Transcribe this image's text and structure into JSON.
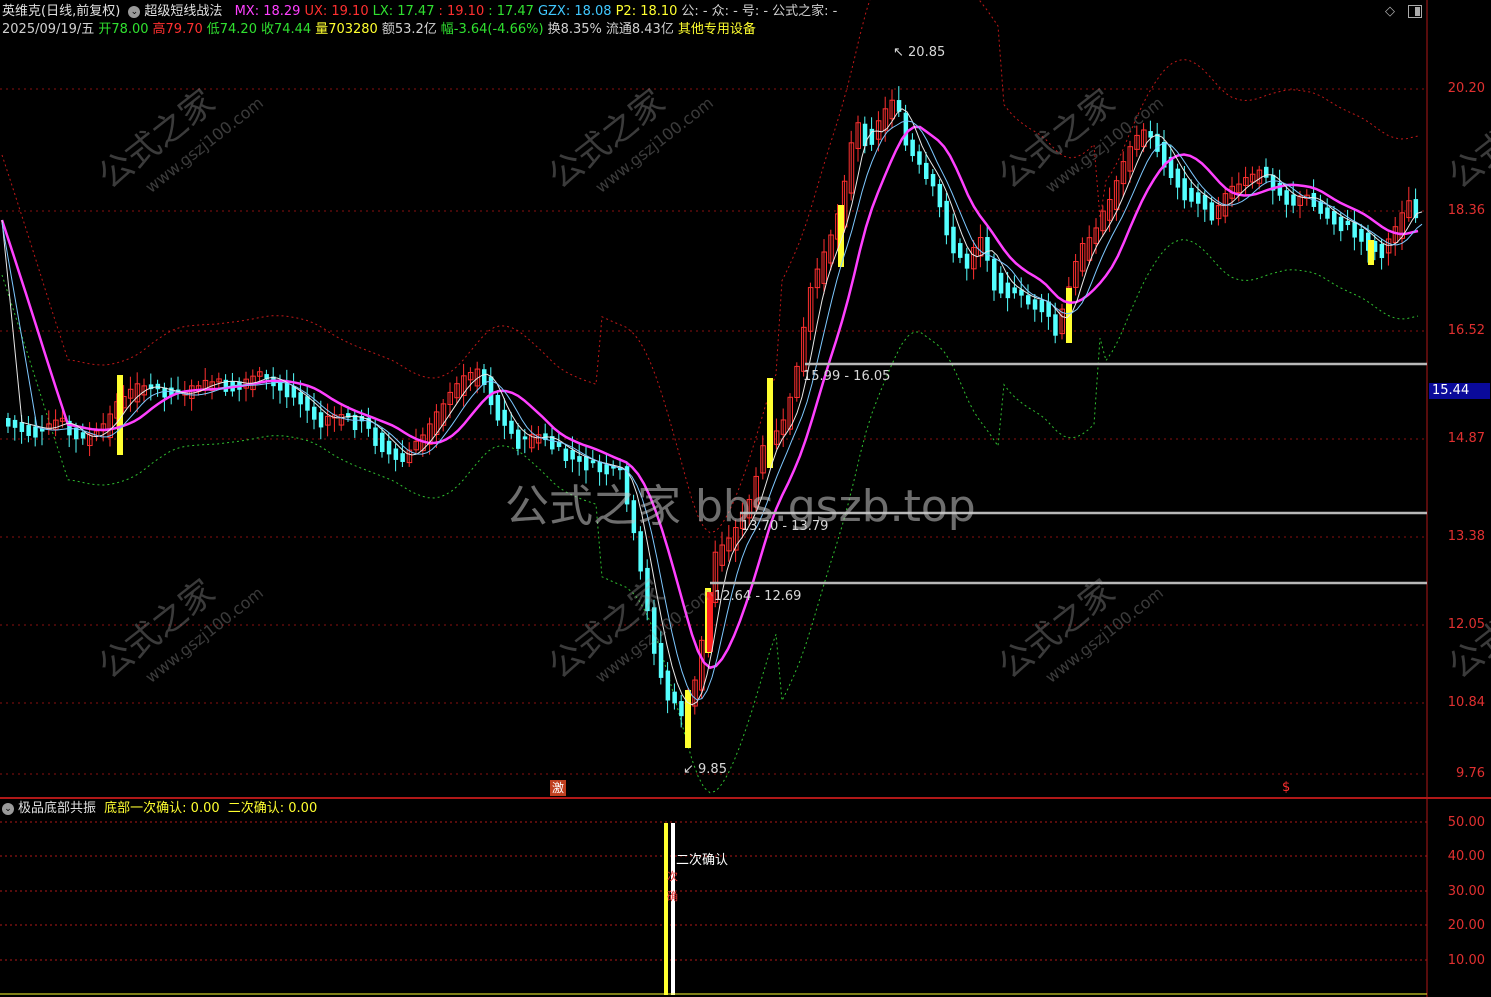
{
  "header": {
    "stock_name": "英维克(日线,前复权)",
    "formula_name": "超级短线战法",
    "indicators": [
      {
        "label": "MX: 18.29",
        "color": "#ff40ff"
      },
      {
        "label": "UX: 19.10",
        "color": "#ff3030"
      },
      {
        "label": "LX: 17.47",
        "color": "#30e030"
      },
      {
        "label": ": 19.10",
        "color": "#ff3030"
      },
      {
        "label": ": 17.47",
        "color": "#30e030"
      },
      {
        "label": "GZX: 18.08",
        "color": "#40c8ff"
      },
      {
        "label": "P2: 18.10",
        "color": "#ffff30"
      },
      {
        "label": "公: -",
        "color": "#d0d0d0"
      },
      {
        "label": "众: -",
        "color": "#d0d0d0"
      },
      {
        "label": "号: -",
        "color": "#d0d0d0"
      },
      {
        "label": "公式之家: -",
        "color": "#d0d0d0"
      }
    ],
    "quote_row": [
      {
        "label": "2025/09/19/五",
        "color": "#d0d0d0"
      },
      {
        "label": "开78.00",
        "color": "#30e030"
      },
      {
        "label": "高79.70",
        "color": "#ff3030"
      },
      {
        "label": "低74.20",
        "color": "#30e030"
      },
      {
        "label": "收74.44",
        "color": "#30e030"
      },
      {
        "label": "量703280",
        "color": "#ffff30"
      },
      {
        "label": "额53.2亿",
        "color": "#d0d0d0"
      },
      {
        "label": "幅-3.64(-4.66%)",
        "color": "#30e030"
      },
      {
        "label": "换8.35%",
        "color": "#d0d0d0"
      },
      {
        "label": "流通8.43亿",
        "color": "#d0d0d0"
      },
      {
        "label": "其他专用设备",
        "color": "#ffff30"
      }
    ]
  },
  "price_axis": {
    "labels": [
      "20.20",
      "18.36",
      "16.52",
      "14.87",
      "13.38",
      "12.05",
      "10.84",
      "9.76"
    ],
    "current_price": "15.44"
  },
  "price_annotations": {
    "high": "20.85",
    "low": "9.85",
    "level_1": "15.99 - 16.05",
    "level_2": "13.70 - 13.79",
    "level_3": "12.64 - 12.69"
  },
  "markers": {
    "marker_1": "激",
    "marker_2": "$"
  },
  "watermark": {
    "main": "公式之家 bbs.gszb.top",
    "tile_text": "公式之家",
    "tile_url": "www.gszj100.com"
  },
  "sub_panel": {
    "name": "极品底部共振",
    "line1": "底部一次确认: 0.00",
    "line2": "二次确认: 0.00",
    "signal_label": "二次确认",
    "axis_labels": [
      "50.00",
      "40.00",
      "30.00",
      "20.00",
      "10.00"
    ]
  },
  "colors": {
    "background": "#000000",
    "frame": "#b01818",
    "up_candle": "#ff3030",
    "down_candle": "#54ffff",
    "mid_line": "#ff40ff",
    "upper_band": "#c01818",
    "lower_band": "#30c030",
    "signal_bar": "#ffff30"
  }
}
